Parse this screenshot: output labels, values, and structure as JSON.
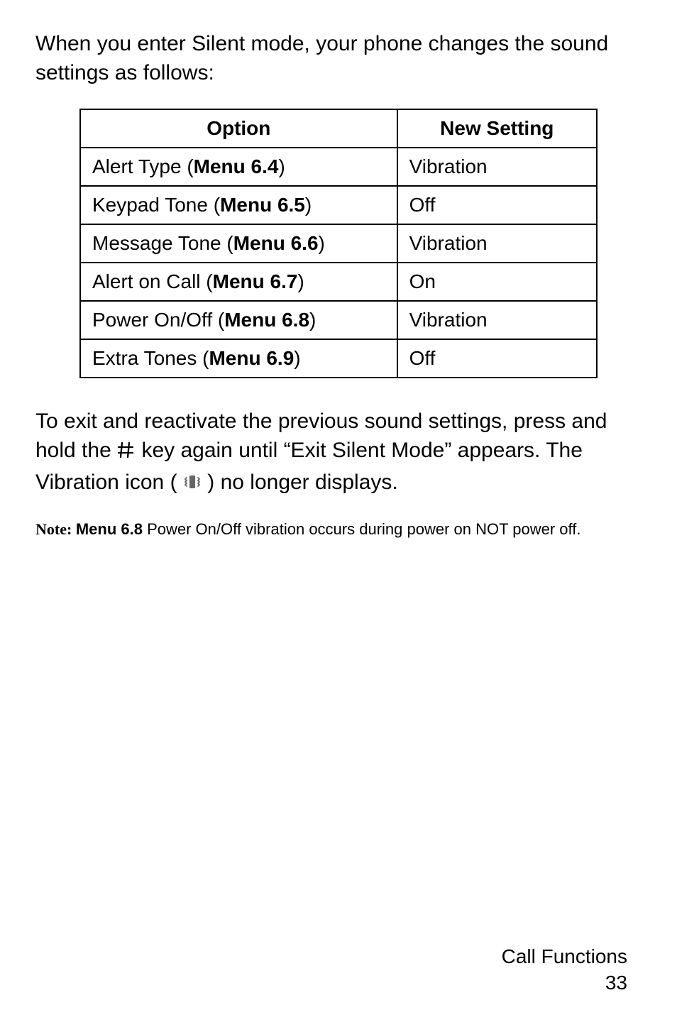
{
  "intro": "When you enter Silent mode, your phone changes the sound settings as follows:",
  "table": {
    "header_option": "Option",
    "header_setting": "New Setting",
    "rows": [
      {
        "opt_pre": "Alert Type (",
        "opt_bold": "Menu 6.4",
        "opt_post": ")",
        "val": "Vibration"
      },
      {
        "opt_pre": "Keypad Tone (",
        "opt_bold": "Menu 6.5",
        "opt_post": ")",
        "val": "Off"
      },
      {
        "opt_pre": "Message Tone (",
        "opt_bold": "Menu 6.6",
        "opt_post": ")",
        "val": "Vibration"
      },
      {
        "opt_pre": "Alert on Call (",
        "opt_bold": "Menu 6.7",
        "opt_post": ")",
        "val": "On"
      },
      {
        "opt_pre": "Power On/Off (",
        "opt_bold": "Menu 6.8",
        "opt_post": ")",
        "val": "Vibration"
      },
      {
        "opt_pre": "Extra Tones (",
        "opt_bold": "Menu 6.9",
        "opt_post": ")",
        "val": "Off"
      }
    ]
  },
  "exit": {
    "part1": "To exit and reactivate the previous sound settings, press and hold the ",
    "part2": " key again until “Exit Silent Mode” appears. The Vibration icon (",
    "part3": ") no longer displays."
  },
  "note": {
    "label": "Note: ",
    "menu": "Menu 6.8",
    "rest": " Power On/Off vibration occurs during power on NOT power off."
  },
  "footer": {
    "section": "Call Functions",
    "page": "33"
  }
}
